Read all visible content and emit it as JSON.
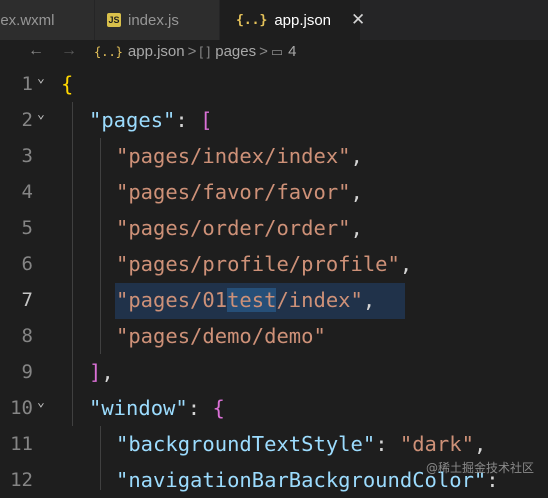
{
  "tabs": [
    {
      "label": "dex.wxml",
      "active": false
    },
    {
      "label": "index.js",
      "icon": "JS",
      "active": false
    },
    {
      "label": "app.json",
      "icon": "{..}",
      "active": true,
      "close": "✕"
    }
  ],
  "breadcrumb": {
    "back": "←",
    "forward": "→",
    "json_icon": "{..}",
    "file": "app.json",
    "sep1": ">",
    "array_icon": "[ ]",
    "segment": "pages",
    "sep2": ">",
    "item_icon": "▭",
    "index": "4"
  },
  "editor": {
    "current_line": "7",
    "lines": [
      {
        "num": "1",
        "fold": "⌄"
      },
      {
        "num": "2",
        "fold": "⌄",
        "key": "\"pages\"",
        "colon": ": ",
        "bracket": "["
      },
      {
        "num": "3",
        "str": "\"pages/index/index\"",
        "comma": ","
      },
      {
        "num": "4",
        "str": "\"pages/favor/favor\"",
        "comma": ","
      },
      {
        "num": "5",
        "str": "\"pages/order/order\"",
        "comma": ","
      },
      {
        "num": "6",
        "str": "\"pages/profile/profile\"",
        "comma": ","
      },
      {
        "num": "7",
        "str_pre": "\"pages/01",
        "str_sel": "test",
        "str_post": "/index\"",
        "comma": ","
      },
      {
        "num": "8",
        "str": "\"pages/demo/demo\""
      },
      {
        "num": "9",
        "close": "]",
        "comma": ","
      },
      {
        "num": "10",
        "fold": "⌄",
        "key": "\"window\"",
        "colon": ": ",
        "bracket": "{"
      },
      {
        "num": "11",
        "key": "\"backgroundTextStyle\"",
        "colon": ": ",
        "str": "\"dark\"",
        "comma": ","
      },
      {
        "num": "12",
        "key": "\"navigationBarBackgroundColor\"",
        "colon": ": "
      }
    ],
    "line1_brace": "{"
  },
  "watermark": "@稀土掘金技术社区",
  "colors": {
    "key": "#9cdcfe",
    "string": "#ce9178",
    "bracket_level1": "#ffd700",
    "bracket_level2": "#da70d6",
    "bracket_level3": "#179fff",
    "selection": "#264f78",
    "background": "#1e1e1e"
  }
}
